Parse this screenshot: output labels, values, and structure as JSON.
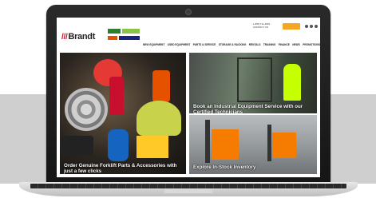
{
  "header": {
    "brand": "Brandt",
    "utility": {
      "phone": "1-855-711-4545 · CONTACT US",
      "quote_label": "REQUEST QUOTE"
    },
    "nav": [
      "NEW EQUIPMENT",
      "USED EQUIPMENT",
      "PARTS & SERVICE",
      "STORAGE & RACKING",
      "RENTALS",
      "TRAINING",
      "FINANCE",
      "NEWS",
      "PROMOTIONS"
    ]
  },
  "tiles": {
    "main": {
      "caption": "Order Genuine Forklift Parts & Accessories with just a few clicks"
    },
    "service": {
      "caption": "Book an Industrial Equipment Service with our Certified Technicians"
    },
    "inventory": {
      "caption": "Explore In-Stock Inventory"
    }
  },
  "colors": {
    "brand_red": "#c8102e",
    "accent_orange": "#f5a623",
    "caption_text": "#ffffff"
  }
}
